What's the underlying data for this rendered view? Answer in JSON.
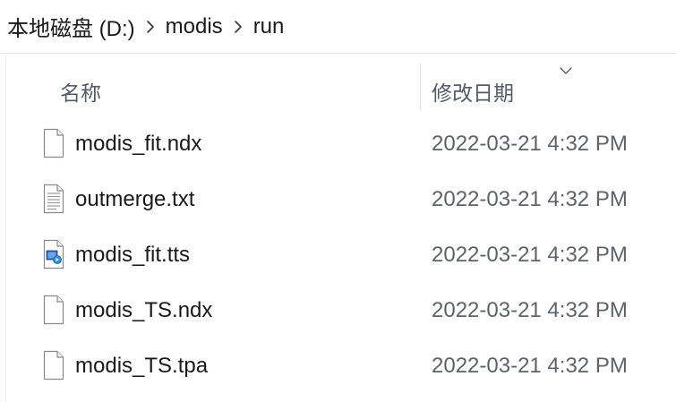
{
  "breadcrumb": {
    "items": [
      {
        "label": "本地磁盘 (D:)"
      },
      {
        "label": "modis"
      },
      {
        "label": "run"
      }
    ]
  },
  "columns": {
    "name_label": "名称",
    "date_label": "修改日期",
    "sort_icon": "chevron-down-icon"
  },
  "files": [
    {
      "name": "modis_fit.ndx",
      "modified": "2022-03-21 4:32 PM",
      "icon": "blank-file-icon"
    },
    {
      "name": "outmerge.txt",
      "modified": "2022-03-21 4:32 PM",
      "icon": "text-file-icon"
    },
    {
      "name": "modis_fit.tts",
      "modified": "2022-03-21 4:32 PM",
      "icon": "media-file-icon"
    },
    {
      "name": "modis_TS.ndx",
      "modified": "2022-03-21 4:32 PM",
      "icon": "blank-file-icon"
    },
    {
      "name": "modis_TS.tpa",
      "modified": "2022-03-21 4:32 PM",
      "icon": "blank-file-icon"
    }
  ]
}
